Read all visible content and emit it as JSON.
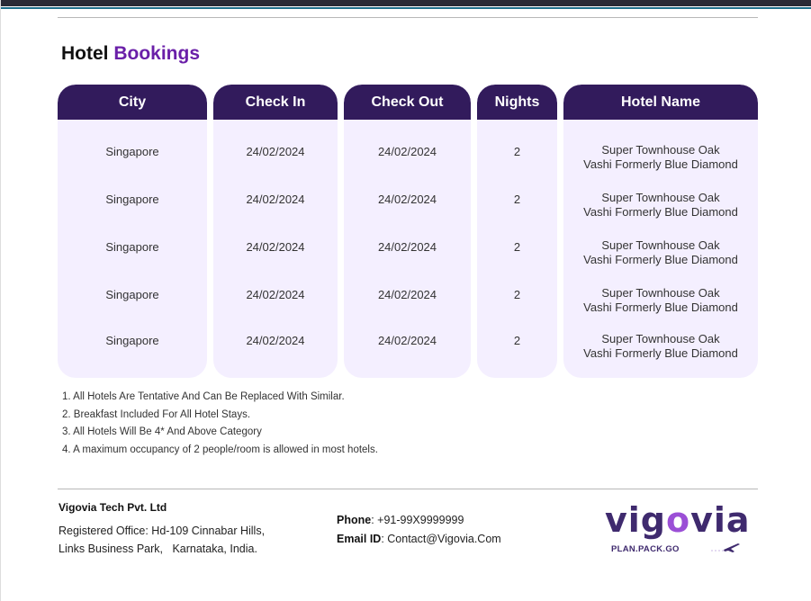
{
  "page": {
    "title_main": "Hotel",
    "title_accent": "Bookings"
  },
  "table": {
    "headers": {
      "city": "City",
      "check_in": "Check In",
      "check_out": "Check Out",
      "nights": "Nights",
      "hotel_name": "Hotel Name"
    },
    "rows": [
      {
        "city": "Singapore",
        "check_in": "24/02/2024",
        "check_out": "24/02/2024",
        "nights": "2",
        "hotel_line1": "Super Townhouse Oak",
        "hotel_line2": "Vashi Formerly Blue Diamond"
      },
      {
        "city": "Singapore",
        "check_in": "24/02/2024",
        "check_out": "24/02/2024",
        "nights": "2",
        "hotel_line1": "Super Townhouse Oak",
        "hotel_line2": "Vashi Formerly Blue Diamond"
      },
      {
        "city": "Singapore",
        "check_in": "24/02/2024",
        "check_out": "24/02/2024",
        "nights": "2",
        "hotel_line1": "Super Townhouse Oak",
        "hotel_line2": "Vashi Formerly Blue Diamond"
      },
      {
        "city": "Singapore",
        "check_in": "24/02/2024",
        "check_out": "24/02/2024",
        "nights": "2",
        "hotel_line1": "Super Townhouse Oak",
        "hotel_line2": "Vashi Formerly Blue Diamond"
      },
      {
        "city": "Singapore",
        "check_in": "24/02/2024",
        "check_out": "24/02/2024",
        "nights": "2",
        "hotel_line1": "Super Townhouse Oak",
        "hotel_line2": "Vashi Formerly Blue Diamond"
      }
    ]
  },
  "notes": [
    "1. All Hotels Are Tentative And Can Be Replaced With Similar.",
    "2. Breakfast Included For All Hotel Stays.",
    "3. All Hotels Will Be 4* And Above Category",
    "4. A maximum occupancy of 2 people/room is allowed in most hotels."
  ],
  "footer": {
    "company": "Vigovia Tech Pvt. Ltd",
    "office_line1": "Registered Office: Hd-109 Cinnabar Hills,",
    "office_line2": "Links Business Park,   Karnataka, India.",
    "phone_label": "Phone",
    "phone_value": ": +91-99X9999999",
    "email_label": "Email ID",
    "email_value": ": Contact@Vigovia.Com"
  },
  "logo": {
    "part1": "vig",
    "part2": "o",
    "part3": "via",
    "tagline": "PLAN.PACK.GO",
    "icon": "airplane-icon"
  },
  "colors": {
    "header_bg": "#321b5c",
    "column_bg": "#f4efff",
    "accent": "#6a1fa8"
  }
}
